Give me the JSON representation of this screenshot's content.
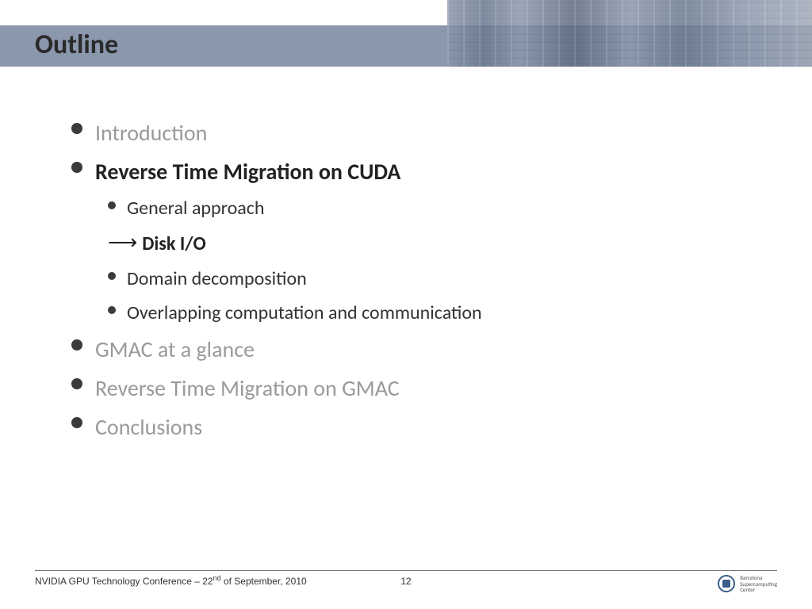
{
  "title": "Outline",
  "bullets": {
    "intro": "Introduction",
    "rtm_cuda": "Reverse Time Migration on CUDA",
    "sub_general": "General approach",
    "sub_disk": "Disk I/O",
    "sub_domain": "Domain decomposition",
    "sub_overlap": "Overlapping computation and communication",
    "gmac": "GMAC at a glance",
    "rtm_gmac": "Reverse Time Migration on GMAC",
    "conclusions": "Conclusions"
  },
  "footer": {
    "conference_prefix": "NVIDIA GPU Technology Conference – 22",
    "conference_suffix": " of September, 2010",
    "ordinal": "nd",
    "page": "12",
    "org1": "Barcelona",
    "org2": "Supercomputing",
    "org3": "Center"
  }
}
